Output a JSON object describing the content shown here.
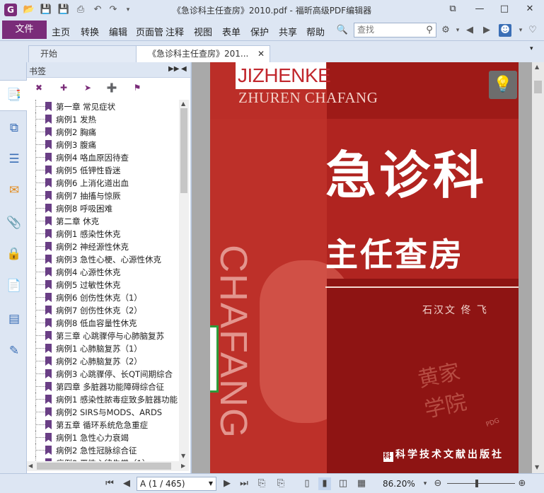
{
  "window": {
    "title": "《急诊科主任查房》2010.pdf - 福昕高级PDF编辑器",
    "app_icon": "G",
    "controls": [
      "restore-down",
      "minimize",
      "maximize",
      "close"
    ]
  },
  "quick_access": [
    "open-icon",
    "save-icon",
    "save-as-icon",
    "print-icon",
    "undo-icon",
    "redo-icon",
    "customize-icon"
  ],
  "menu": {
    "file": "文件",
    "items": [
      "主页",
      "转换",
      "编辑",
      "页面管理",
      "注释",
      "视图",
      "表单",
      "保护",
      "共享",
      "帮助"
    ]
  },
  "search": {
    "placeholder": "查找"
  },
  "tabs": [
    {
      "label": "开始"
    },
    {
      "label": "《急诊科主任查房》201..."
    }
  ],
  "panel": {
    "title": "书签",
    "bookmarks": [
      "第一章  常见症状",
      "病例1  发热",
      "病例2  胸痛",
      "病例3  腹痛",
      "病例4  咯血原因待查",
      "病例5  低钾性昏迷",
      "病例6  上消化道出血",
      "病例7  抽搐与惊厥",
      "病例8  呼吸困难",
      "第二章  休克",
      "病例1  感染性休克",
      "病例2  神经源性休克",
      "病例3  急性心梗、心源性休克",
      "病例4  心源性休克",
      "病例5  过敏性休克",
      "病例6  创伤性休克（1）",
      "病例7  创伤性休克（2）",
      "病例8  低血容量性休克",
      "第三章  心跳骤停与心肺脑复苏",
      "病例1  心肺脑复苏（1）",
      "病例2  心肺脑复苏（2）",
      "病例3  心跳骤停、长QT间期综合",
      "第四章  多脏器功能障碍综合征",
      "病例1  感染性脓毒症致多脏器功能",
      "病例2  SIRS与MODS、ARDS",
      "第五章  循环系统危急重症",
      "病例1  急性心力衰竭",
      "病例2  急性冠脉综合征",
      "病例3  严性心律失常（1）"
    ]
  },
  "cover": {
    "brand_box": "JIZHENKE",
    "subtitle_en": "ZHUREN CHAFANG",
    "title_main": "急诊科",
    "title_sub": "主任查房",
    "authors": "石汉文  佟  飞",
    "vertical_text": "CHAFANG",
    "seal_text": "黄家学院",
    "seal_tag": "PDG",
    "publisher": "科学技术文献出版社",
    "publisher_mark": "科"
  },
  "status": {
    "page": "A (1 / 465)",
    "zoom": "86.20%"
  },
  "colors": {
    "accent": "#7a2c79",
    "chrome": "#dde6f3",
    "cover_red": "#b4231f"
  }
}
